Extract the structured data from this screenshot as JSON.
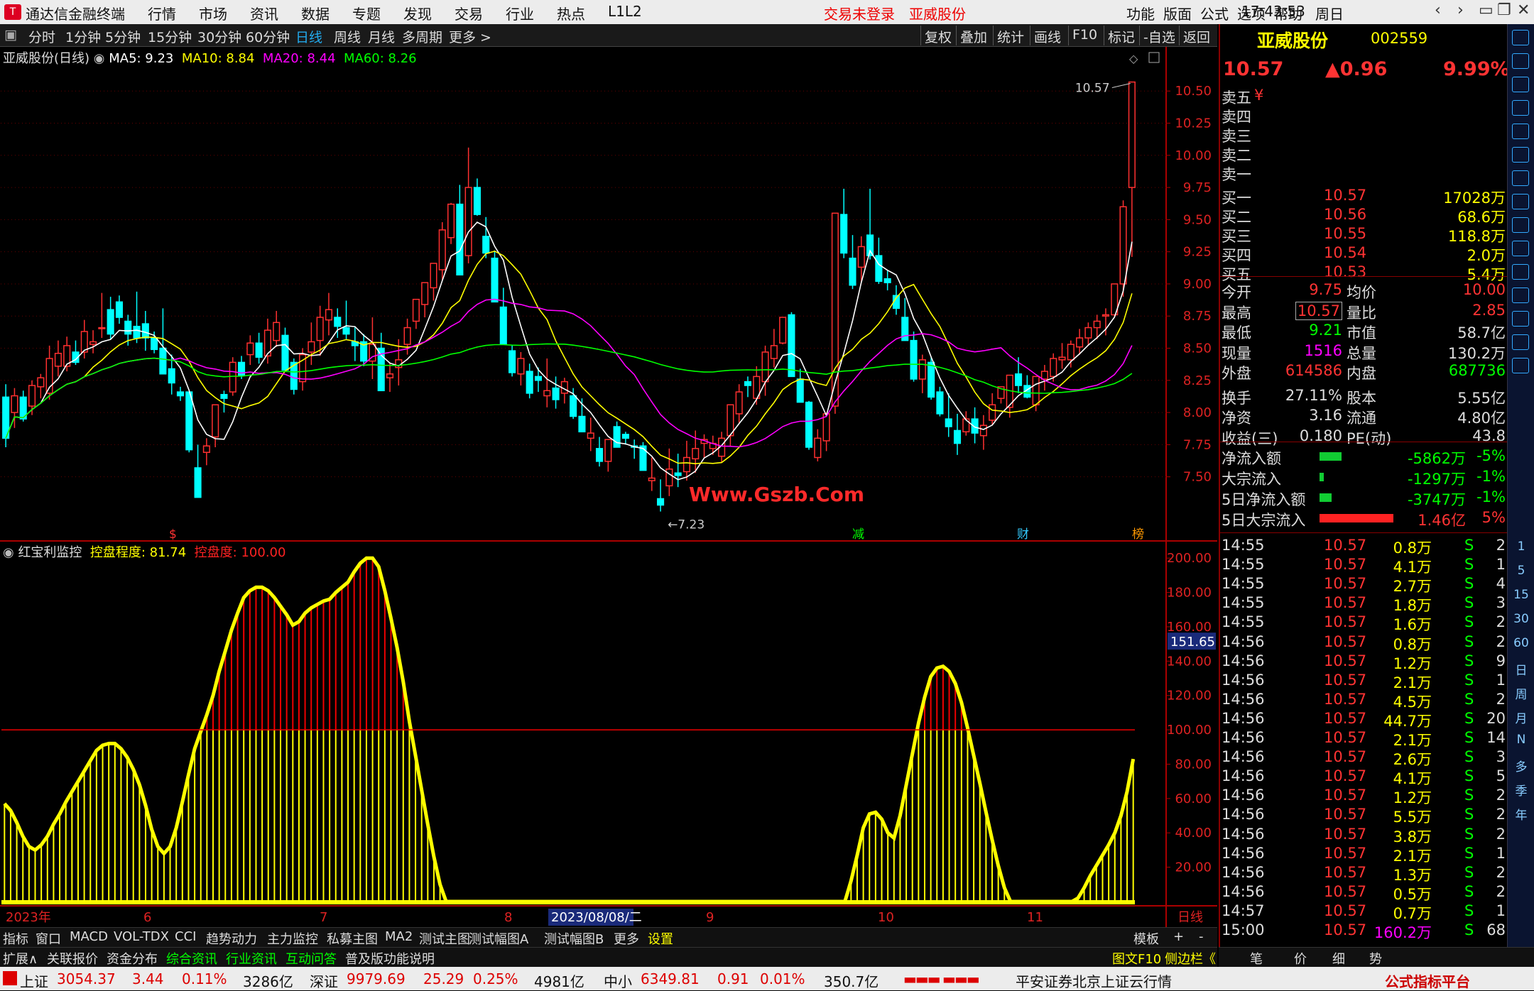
{
  "menubar": {
    "app_title": "通达信金融终端",
    "menu": [
      "行情",
      "市场",
      "资讯",
      "数据",
      "专题",
      "发现",
      "交易",
      "行业",
      "热点",
      "L1L2"
    ],
    "center": [
      "交易未登录",
      "亚威股份"
    ],
    "right": [
      "功能",
      "版面",
      "公式",
      "选项",
      "帮助"
    ],
    "time": "17:43:53",
    "weekday": "周日"
  },
  "tabbar": {
    "periods": [
      "分时",
      "1分钟",
      "5分钟",
      "15分钟",
      "30分钟",
      "60分钟",
      "日线",
      "周线",
      "月线",
      "多周期",
      "更多 >"
    ],
    "active": "日线",
    "tools": [
      "复权",
      "叠加",
      "统计",
      "画线",
      "F10",
      "标记",
      "-自选",
      "返回"
    ]
  },
  "main_legend": {
    "name": "亚威股份(日线)",
    "ma5": "MA5: 9.23",
    "ma10": "MA10: 8.84",
    "ma20": "MA20: 8.44",
    "ma60": "MA60: 8.26"
  },
  "ind_legend": {
    "name": "红宝利监控",
    "k1": "控盘程度: 81.74",
    "k2": "控盘度: 100.00"
  },
  "colors": {
    "up": "#ff3030",
    "down": "#00ffff",
    "ma5": "#ffffff",
    "ma10": "#ffff00",
    "ma20": "#ff00ff",
    "ma60": "#00ff00",
    "bar_yellow": "#ffff00",
    "bar_red": "#ee0000"
  },
  "annotations": {
    "high_label": "10.57",
    "low_label": "7.23",
    "watermark": "Www.Gszb.Com",
    "markers": [
      "$",
      "减",
      "财",
      "榜"
    ],
    "cursor_value": "151.65"
  },
  "x_axis": [
    "2023年",
    "6",
    "7",
    "8",
    "2023/08/08/二",
    "9",
    "10",
    "11",
    "日线"
  ],
  "bottom1": [
    "指标",
    "窗口",
    "MACD",
    "VOL-TDX",
    "CCI",
    "趋势动力",
    "主力监控",
    "私募主图",
    "MA2",
    "测试主图",
    "测试幅图A",
    "测试幅图B",
    "更多",
    "设置"
  ],
  "bottom1_right": [
    "模板",
    "+",
    "-"
  ],
  "bottom2": [
    "扩展∧",
    "关联报价",
    "资金分布",
    "综合资讯",
    "行业资讯",
    "互动问答",
    "普及版功能说明"
  ],
  "bottom2_right": [
    "图文F10",
    "侧边栏《"
  ],
  "quote": {
    "name": "亚威股份",
    "code": "002559",
    "price": "10.57",
    "change": "▲0.96",
    "pct": "9.99%"
  },
  "order_book": [
    {
      "l": "卖五",
      "p": "¥",
      "v": ""
    },
    {
      "l": "卖四",
      "p": "",
      "v": ""
    },
    {
      "l": "卖三",
      "p": "",
      "v": ""
    },
    {
      "l": "卖二",
      "p": "",
      "v": ""
    },
    {
      "l": "卖一",
      "p": "",
      "v": ""
    },
    {
      "l": "买一",
      "p": "10.57",
      "v": "17028万"
    },
    {
      "l": "买二",
      "p": "10.56",
      "v": "68.6万"
    },
    {
      "l": "买三",
      "p": "10.55",
      "v": "118.8万"
    },
    {
      "l": "买四",
      "p": "10.54",
      "v": "2.0万"
    },
    {
      "l": "买五",
      "p": "10.53",
      "v": "5.4万"
    }
  ],
  "stats": [
    [
      "今开",
      "9.75",
      "均价",
      "10.00"
    ],
    [
      "最高",
      "10.57",
      "量比",
      "2.85"
    ],
    [
      "最低",
      "9.21",
      "市值",
      "58.7亿"
    ],
    [
      "现量",
      "1516",
      "总量",
      "130.2万"
    ],
    [
      "外盘",
      "614586",
      "内盘",
      "687736"
    ],
    [
      "换手",
      "27.11%",
      "股本",
      "5.55亿"
    ],
    [
      "净资",
      "3.16",
      "流通",
      "4.80亿"
    ],
    [
      "收益(三)",
      "0.180",
      "PE(动)",
      "43.8"
    ]
  ],
  "flows": [
    {
      "l": "净流入额",
      "v": "-5862万",
      "p": "-5%",
      "bar": 0.3
    },
    {
      "l": "大宗流入",
      "v": "-1297万",
      "p": "-1%",
      "bar": 0.06
    },
    {
      "l": "5日净流入额",
      "v": "-3747万",
      "p": "-1%",
      "bar": 0.16
    },
    {
      "l": "5日大宗流入",
      "v": "1.46亿",
      "p": "5%",
      "bar": 1.0
    }
  ],
  "ticks": [
    [
      "14:55",
      "10.57",
      "0.8万",
      "S",
      "2"
    ],
    [
      "14:55",
      "10.57",
      "4.1万",
      "S",
      "1"
    ],
    [
      "14:55",
      "10.57",
      "2.7万",
      "S",
      "4"
    ],
    [
      "14:55",
      "10.57",
      "1.8万",
      "S",
      "3"
    ],
    [
      "14:55",
      "10.57",
      "1.6万",
      "S",
      "2"
    ],
    [
      "14:56",
      "10.57",
      "0.8万",
      "S",
      "2"
    ],
    [
      "14:56",
      "10.57",
      "1.2万",
      "S",
      "9"
    ],
    [
      "14:56",
      "10.57",
      "2.1万",
      "S",
      "1"
    ],
    [
      "14:56",
      "10.57",
      "4.5万",
      "S",
      "2"
    ],
    [
      "14:56",
      "10.57",
      "44.7万",
      "S",
      "20"
    ],
    [
      "14:56",
      "10.57",
      "2.1万",
      "S",
      "14"
    ],
    [
      "14:56",
      "10.57",
      "2.6万",
      "S",
      "3"
    ],
    [
      "14:56",
      "10.57",
      "4.1万",
      "S",
      "5"
    ],
    [
      "14:56",
      "10.57",
      "1.2万",
      "S",
      "2"
    ],
    [
      "14:56",
      "10.57",
      "5.5万",
      "S",
      "2"
    ],
    [
      "14:56",
      "10.57",
      "3.8万",
      "S",
      "2"
    ],
    [
      "14:56",
      "10.57",
      "2.1万",
      "S",
      "1"
    ],
    [
      "14:56",
      "10.57",
      "1.3万",
      "S",
      "2"
    ],
    [
      "14:56",
      "10.57",
      "0.5万",
      "S",
      "2"
    ],
    [
      "14:57",
      "10.57",
      "0.7万",
      "S",
      "1"
    ],
    [
      "15:00",
      "10.57",
      "160.2万",
      "S",
      "68"
    ]
  ],
  "right_bottom": [
    "笔",
    "价",
    "细",
    "势"
  ],
  "right_toolbar": [
    "1",
    "5",
    "15",
    "30",
    "60",
    "日",
    "周",
    "月",
    "N",
    "多",
    "季",
    "年"
  ],
  "statusbar": {
    "sh": "上证",
    "sh_v": "3054.37",
    "sh_c": "3.44",
    "sh_p": "0.11%",
    "sh_a": "3286亿",
    "sz": "深证",
    "sz_v": "9979.69",
    "sz_c": "25.29",
    "sz_p": "0.25%",
    "sz_a": "4981亿",
    "zx": "中小",
    "zx_v": "6349.81",
    "zx_c": "0.91",
    "zx_p": "0.01%",
    "zx_a": "350.7亿",
    "server": "平安证券北京上证云行情",
    "brand": "公式指标平台"
  },
  "chart_data": [
    {
      "type": "candlestick",
      "title": "亚威股份(日线)",
      "y_axis": {
        "ticks": [
          7.5,
          7.75,
          8.0,
          8.25,
          8.5,
          8.75,
          9.0,
          9.25,
          9.5,
          9.75,
          10.0,
          10.25,
          10.5
        ],
        "ylim": [
          7.2,
          10.7
        ]
      },
      "ohlc": [
        [
          8.12,
          8.22,
          7.73,
          7.8
        ],
        [
          8.0,
          8.19,
          7.88,
          8.13
        ],
        [
          8.12,
          8.17,
          7.93,
          7.95
        ],
        [
          8.05,
          8.25,
          7.98,
          8.21
        ],
        [
          8.2,
          8.3,
          8.11,
          8.27
        ],
        [
          8.15,
          8.52,
          8.1,
          8.42
        ],
        [
          8.36,
          8.56,
          8.28,
          8.46
        ],
        [
          8.36,
          8.59,
          8.32,
          8.52
        ],
        [
          8.47,
          8.56,
          8.37,
          8.39
        ],
        [
          8.47,
          8.72,
          8.42,
          8.63
        ],
        [
          8.53,
          8.64,
          8.46,
          8.55
        ],
        [
          8.66,
          8.93,
          8.58,
          8.66
        ],
        [
          8.8,
          8.9,
          8.57,
          8.61
        ],
        [
          8.86,
          8.91,
          8.69,
          8.74
        ],
        [
          8.71,
          8.76,
          8.52,
          8.61
        ],
        [
          8.67,
          8.94,
          8.54,
          8.58
        ],
        [
          8.69,
          8.79,
          8.48,
          8.58
        ],
        [
          8.58,
          8.63,
          8.46,
          8.49
        ],
        [
          8.5,
          8.81,
          8.32,
          8.3
        ],
        [
          8.34,
          8.45,
          8.14,
          8.23
        ],
        [
          8.16,
          8.2,
          8.09,
          8.13
        ],
        [
          8.16,
          8.15,
          7.69,
          7.71
        ],
        [
          7.57,
          7.75,
          7.36,
          7.34
        ],
        [
          7.69,
          7.8,
          7.59,
          7.74
        ],
        [
          7.81,
          8.04,
          7.73,
          8.06
        ],
        [
          8.14,
          8.17,
          8.0,
          8.11
        ],
        [
          8.16,
          8.43,
          8.13,
          8.39
        ],
        [
          8.39,
          8.44,
          8.26,
          8.29
        ],
        [
          8.45,
          8.6,
          8.37,
          8.54
        ],
        [
          8.54,
          8.62,
          8.38,
          8.43
        ],
        [
          8.44,
          8.73,
          8.38,
          8.64
        ],
        [
          8.56,
          8.79,
          8.51,
          8.7
        ],
        [
          8.6,
          8.66,
          8.38,
          8.33
        ],
        [
          8.39,
          8.42,
          8.14,
          8.18
        ],
        [
          8.24,
          8.5,
          8.17,
          8.45
        ],
        [
          8.47,
          8.7,
          8.37,
          8.55
        ],
        [
          8.56,
          8.83,
          8.44,
          8.74
        ],
        [
          8.72,
          8.93,
          8.6,
          8.8
        ],
        [
          8.74,
          8.81,
          8.58,
          8.67
        ],
        [
          8.66,
          8.87,
          8.57,
          8.61
        ],
        [
          8.55,
          8.67,
          8.4,
          8.52
        ],
        [
          8.55,
          8.61,
          8.36,
          8.4
        ],
        [
          8.4,
          8.74,
          8.26,
          8.53
        ],
        [
          8.5,
          8.62,
          8.21,
          8.17
        ],
        [
          8.27,
          8.39,
          8.16,
          8.3
        ],
        [
          8.35,
          8.57,
          8.21,
          8.41
        ],
        [
          8.53,
          8.73,
          8.45,
          8.66
        ],
        [
          8.71,
          8.84,
          8.65,
          8.88
        ],
        [
          8.84,
          8.98,
          8.74,
          9.01
        ],
        [
          8.97,
          9.15,
          8.87,
          9.16
        ],
        [
          9.11,
          9.48,
          9.03,
          9.42
        ],
        [
          9.36,
          9.63,
          9.31,
          9.62
        ],
        [
          9.62,
          9.77,
          9.1,
          9.07
        ],
        [
          9.22,
          10.06,
          9.16,
          9.75
        ],
        [
          9.75,
          9.82,
          9.53,
          9.54
        ],
        [
          9.37,
          9.52,
          9.2,
          9.24
        ],
        [
          9.2,
          9.26,
          8.87,
          8.86
        ],
        [
          8.82,
          8.97,
          8.56,
          8.53
        ],
        [
          8.48,
          8.52,
          8.28,
          8.31
        ],
        [
          8.3,
          8.47,
          8.21,
          8.42
        ],
        [
          8.32,
          8.38,
          8.11,
          8.15
        ],
        [
          8.28,
          8.35,
          8.16,
          8.25
        ],
        [
          8.13,
          8.42,
          8.04,
          8.17
        ],
        [
          8.19,
          8.28,
          8.03,
          8.1
        ],
        [
          8.15,
          8.27,
          8.07,
          8.24
        ],
        [
          8.13,
          8.19,
          7.95,
          7.97
        ],
        [
          7.97,
          8.11,
          7.85,
          7.85
        ],
        [
          7.8,
          7.96,
          7.7,
          7.84
        ],
        [
          7.72,
          7.81,
          7.58,
          7.62
        ],
        [
          7.62,
          7.74,
          7.54,
          7.79
        ],
        [
          7.89,
          7.93,
          7.73,
          7.73
        ],
        [
          7.83,
          7.85,
          7.75,
          7.8
        ],
        [
          7.74,
          7.79,
          7.64,
          7.73
        ],
        [
          7.74,
          7.77,
          7.55,
          7.55
        ],
        [
          7.47,
          7.65,
          7.39,
          7.49
        ],
        [
          7.33,
          7.48,
          7.23,
          7.28
        ],
        [
          7.43,
          7.72,
          7.35,
          7.56
        ],
        [
          7.53,
          7.68,
          7.42,
          7.51
        ],
        [
          7.54,
          7.78,
          7.47,
          7.65
        ],
        [
          7.64,
          7.86,
          7.53,
          7.72
        ],
        [
          7.76,
          7.83,
          7.65,
          7.79
        ],
        [
          7.72,
          7.82,
          7.67,
          7.76
        ],
        [
          7.66,
          7.85,
          7.61,
          7.8
        ],
        [
          7.82,
          8.05,
          7.74,
          8.06
        ],
        [
          7.99,
          8.22,
          7.92,
          8.16
        ],
        [
          8.24,
          8.28,
          8.12,
          8.21
        ],
        [
          8.11,
          8.36,
          8.06,
          8.28
        ],
        [
          8.24,
          8.52,
          8.13,
          8.47
        ],
        [
          8.42,
          8.65,
          8.35,
          8.52
        ],
        [
          8.54,
          8.74,
          8.53,
          8.74
        ],
        [
          8.76,
          8.78,
          8.3,
          8.28
        ],
        [
          8.26,
          8.34,
          8.14,
          8.08
        ],
        [
          8.08,
          8.09,
          7.71,
          7.73
        ],
        [
          7.65,
          7.87,
          7.62,
          7.8
        ],
        [
          7.78,
          8.0,
          7.7,
          7.99
        ],
        [
          8.05,
          9.55,
          7.99,
          9.55
        ],
        [
          9.54,
          9.74,
          9.2,
          9.24
        ],
        [
          9.2,
          9.38,
          8.96,
          8.99
        ],
        [
          9.13,
          9.37,
          9.01,
          9.29
        ],
        [
          9.38,
          9.74,
          9.19,
          9.22
        ],
        [
          9.22,
          9.36,
          9.0,
          9.02
        ],
        [
          9.04,
          9.11,
          8.95,
          9.01
        ],
        [
          8.91,
          8.99,
          8.76,
          8.81
        ],
        [
          8.74,
          8.89,
          8.59,
          8.56
        ],
        [
          8.56,
          8.63,
          8.24,
          8.26
        ],
        [
          8.26,
          8.45,
          8.15,
          8.41
        ],
        [
          8.39,
          8.43,
          8.1,
          8.12
        ],
        [
          8.16,
          8.2,
          7.97,
          7.99
        ],
        [
          7.95,
          8.15,
          7.81,
          7.89
        ],
        [
          7.86,
          7.99,
          7.67,
          7.76
        ],
        [
          7.85,
          8.01,
          7.82,
          7.95
        ],
        [
          7.95,
          8.04,
          7.76,
          7.84
        ],
        [
          7.82,
          7.98,
          7.71,
          7.9
        ],
        [
          7.94,
          8.15,
          7.9,
          8.06
        ],
        [
          8.11,
          8.17,
          8.07,
          8.2
        ],
        [
          8.04,
          8.29,
          7.96,
          8.29
        ],
        [
          8.3,
          8.43,
          8.15,
          8.21
        ],
        [
          8.21,
          8.29,
          8.11,
          8.12
        ],
        [
          8.06,
          8.28,
          8.01,
          8.28
        ],
        [
          8.26,
          8.37,
          8.17,
          8.32
        ],
        [
          8.28,
          8.46,
          8.24,
          8.42
        ],
        [
          8.41,
          8.54,
          8.34,
          8.43
        ],
        [
          8.41,
          8.56,
          8.35,
          8.53
        ],
        [
          8.51,
          8.65,
          8.45,
          8.58
        ],
        [
          8.58,
          8.7,
          8.52,
          8.66
        ],
        [
          8.66,
          8.76,
          8.57,
          8.71
        ],
        [
          8.75,
          8.81,
          8.6,
          8.76
        ],
        [
          8.76,
          9.0,
          8.74,
          9.0
        ],
        [
          9.0,
          9.65,
          8.9,
          9.6
        ],
        [
          9.75,
          10.57,
          9.21,
          10.57
        ]
      ],
      "ma_series": [
        {
          "name": "MA5",
          "last": 9.23
        },
        {
          "name": "MA10",
          "last": 8.84
        },
        {
          "name": "MA20",
          "last": 8.44
        },
        {
          "name": "MA60",
          "last": 8.26
        }
      ]
    },
    {
      "type": "bar",
      "title": "红宝利监控",
      "y_axis": {
        "ticks": [
          20,
          40,
          60,
          80,
          100,
          120,
          140,
          160,
          180,
          200
        ],
        "ylim": [
          0,
          210
        ]
      },
      "reference_line": 100,
      "values": [
        57,
        53,
        46,
        38,
        32,
        30,
        33,
        38,
        45,
        51,
        58,
        64,
        70,
        76,
        82,
        88,
        91,
        92,
        92,
        89,
        84,
        77,
        68,
        56,
        42,
        32,
        28,
        32,
        43,
        58,
        74,
        89,
        99,
        109,
        120,
        134,
        146,
        158,
        168,
        177,
        181,
        183,
        183,
        181,
        177,
        172,
        167,
        161,
        163,
        168,
        171,
        173,
        175,
        176,
        180,
        183,
        186,
        192,
        197,
        200,
        200,
        195,
        181,
        165,
        148,
        128,
        105,
        85,
        65,
        45,
        26,
        10,
        0,
        0,
        0,
        0,
        0,
        0,
        0,
        0,
        0,
        0,
        0,
        0,
        0,
        0,
        0,
        0,
        0,
        0,
        0,
        0,
        0,
        0,
        0,
        0,
        0,
        0,
        0,
        0,
        0,
        0,
        0,
        0,
        0,
        0,
        0,
        0,
        0,
        0,
        0,
        0,
        0,
        0,
        0,
        0,
        0,
        0,
        0,
        0,
        0,
        0,
        0,
        0,
        0,
        0,
        0,
        0,
        0,
        0,
        0,
        0,
        0,
        0,
        0,
        0,
        0,
        0,
        12,
        27,
        43,
        51,
        52,
        48,
        40,
        37,
        50,
        68,
        86,
        104,
        119,
        131,
        136,
        137,
        134,
        127,
        116,
        101,
        85,
        69,
        52,
        36,
        21,
        8,
        0,
        0,
        0,
        0,
        0,
        0,
        0,
        0,
        0,
        0,
        0,
        2,
        8,
        15,
        21,
        27,
        33,
        40,
        50,
        64,
        83
      ]
    }
  ]
}
